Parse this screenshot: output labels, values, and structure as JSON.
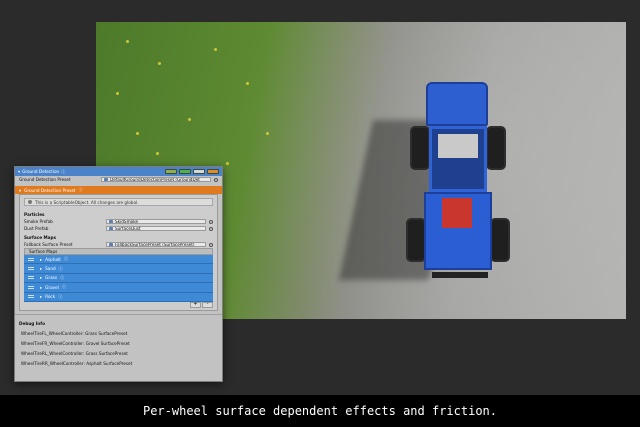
{
  "panel": {
    "title": "Ground Detection",
    "ground_detection_preset_label": "Ground Detection Preset",
    "ground_detection_preset_value": "DefaultGroundDetectionPreset (GroundDet",
    "preset_bar_title": "Ground Detection Preset",
    "note": "This is a ScriptableObject. All changes are global.",
    "particles_header": "Particles",
    "smoke_label": "Smoke Prefab",
    "smoke_value": "SkidSmoke",
    "dust_label": "Dust Prefab",
    "dust_value": "SurfaceDust",
    "surface_maps_header": "Surface Maps",
    "fallback_label": "Fallback Surface Preset",
    "fallback_value": "FallbackSurfacePreset (SurfacePreset)",
    "list_header": "Surface Maps",
    "surface_maps": [
      "Asphalt",
      "Sand",
      "Grass",
      "Gravel",
      "Rock"
    ],
    "add_button": "+",
    "remove_button": "-",
    "debug_header": "Debug Info",
    "debug_lines": [
      "WheelTireFL_WheelController: Grass SurfacePreset",
      "WheelTireFR_WheelController: Gravel SurfacePreset",
      "WheelTireRL_WheelController: Grass SurfacePreset",
      "WheelTireRR_WheelController: Asphalt SurfacePreset"
    ]
  },
  "colors": {
    "title_bar": "#4a83c9",
    "preset_bar": "#e07a1f",
    "list_selected": "#3f8ad6",
    "truck_body": "#2d5fd0"
  },
  "caption": "Per-wheel surface dependent effects and friction."
}
